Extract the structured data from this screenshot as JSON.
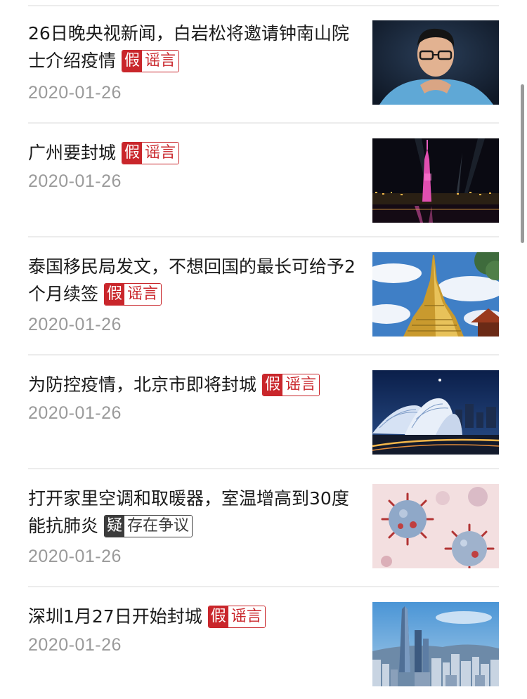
{
  "articles": [
    {
      "title": "26日晚央视新闻，白岩松将邀请钟南山院士介绍疫情",
      "tag_key": "假",
      "tag_text": "谣言",
      "tag_type": "fake",
      "date": "2020-01-26",
      "thumb_icon": "portrait-man-photo"
    },
    {
      "title": "广州要封城",
      "tag_key": "假",
      "tag_text": "谣言",
      "tag_type": "fake",
      "date": "2020-01-26",
      "thumb_icon": "canton-tower-night-photo"
    },
    {
      "title": "泰国移民局发文，不想回国的最长可给予2个月续签",
      "tag_key": "假",
      "tag_text": "谣言",
      "tag_type": "fake",
      "date": "2020-01-26",
      "thumb_icon": "golden-pagoda-photo"
    },
    {
      "title": "为防控疫情，北京市即将封城",
      "tag_key": "假",
      "tag_text": "谣言",
      "tag_type": "fake",
      "date": "2020-01-26",
      "thumb_icon": "beijing-night-city-photo"
    },
    {
      "title": "打开家里空调和取暖器，室温增高到30度能抗肺炎",
      "tag_key": "疑",
      "tag_text": "存在争议",
      "tag_type": "dispute",
      "date": "2020-01-26",
      "thumb_icon": "virus-illustration-photo"
    },
    {
      "title": "深圳1月27日开始封城",
      "tag_key": "假",
      "tag_text": "谣言",
      "tag_type": "fake",
      "date": "2020-01-26",
      "thumb_icon": "shenzhen-skyline-photo"
    }
  ],
  "colors": {
    "fake_tag": "#c9262b",
    "dispute_tag": "#3c3c3c",
    "title_text": "#1a1a1a",
    "date_text": "#9a9a9a",
    "divider": "#ececec"
  }
}
